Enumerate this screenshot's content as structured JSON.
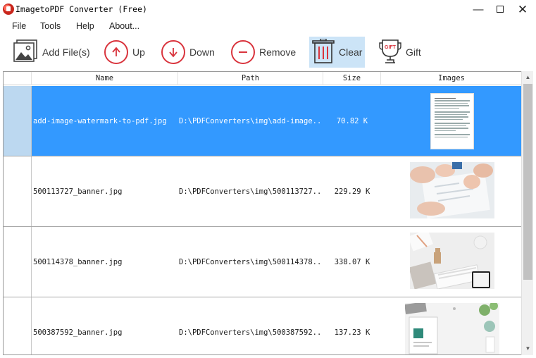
{
  "window": {
    "title": "ImagetoPDF Converter (Free)",
    "min_glyph": "—",
    "close_glyph": "✕"
  },
  "menu": [
    "File",
    "Tools",
    "Help",
    "About..."
  ],
  "toolbar": {
    "add_files": "Add File(s)",
    "up": "Up",
    "down": "Down",
    "remove": "Remove",
    "clear": "Clear",
    "gift": "Gift",
    "gift_badge": "GIFT"
  },
  "table": {
    "headers": [
      "Name",
      "Path",
      "Size",
      "Images"
    ],
    "rows": [
      {
        "name": "add-image-watermark-to-pdf.jpg",
        "path": "D:\\PDFConverters\\img\\add-image...",
        "size": "70.82 K",
        "thumb": "document",
        "selected": true
      },
      {
        "name": "500113727_banner.jpg",
        "path": "D:\\PDFConverters\\img\\500113727...",
        "size": "229.29 K",
        "thumb": "hands-paper",
        "selected": false
      },
      {
        "name": "500114378_banner.jpg",
        "path": "D:\\PDFConverters\\img\\500114378...",
        "size": "338.07 K",
        "thumb": "desk-keyboard",
        "selected": false
      },
      {
        "name": "500387592_banner.jpg",
        "path": "D:\\PDFConverters\\img\\500387592...",
        "size": "137.23 K",
        "thumb": "desk-notebook",
        "selected": false
      }
    ]
  },
  "colors": {
    "accent_red": "#d9343d",
    "selection": "#3399ff",
    "active_button": "#cce4f7"
  }
}
